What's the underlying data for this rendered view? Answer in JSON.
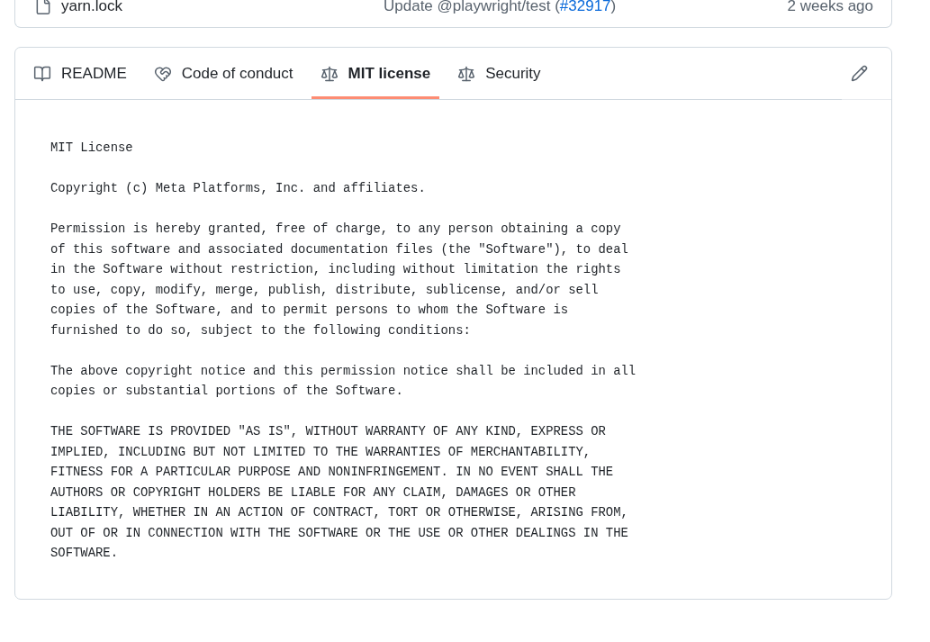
{
  "file_row": {
    "name": "yarn.lock",
    "commit_message": "Update @playwright/test (",
    "commit_link": "#32917",
    "commit_message_end": ")",
    "time": "2 weeks ago"
  },
  "tabs": [
    {
      "kind": "book",
      "label": "README",
      "selected": false
    },
    {
      "kind": "handshake",
      "label": "Code of conduct",
      "selected": false
    },
    {
      "kind": "scale",
      "label": "MIT license",
      "selected": true
    },
    {
      "kind": "scale",
      "label": "Security",
      "selected": false
    }
  ],
  "license": {
    "title": "MIT License",
    "paragraphs": [
      "Copyright (c) Meta Platforms, Inc. and affiliates.",
      "Permission is hereby granted, free of charge, to any person obtaining a copy\nof this software and associated documentation files (the \"Software\"), to deal\nin the Software without restriction, including without limitation the rights\nto use, copy, modify, merge, publish, distribute, sublicense, and/or sell\ncopies of the Software, and to permit persons to whom the Software is\nfurnished to do so, subject to the following conditions:",
      "The above copyright notice and this permission notice shall be included in all\ncopies or substantial portions of the Software.",
      "THE SOFTWARE IS PROVIDED \"AS IS\", WITHOUT WARRANTY OF ANY KIND, EXPRESS OR\nIMPLIED, INCLUDING BUT NOT LIMITED TO THE WARRANTIES OF MERCHANTABILITY,\nFITNESS FOR A PARTICULAR PURPOSE AND NONINFRINGEMENT. IN NO EVENT SHALL THE\nAUTHORS OR COPYRIGHT HOLDERS BE LIABLE FOR ANY CLAIM, DAMAGES OR OTHER\nLIABILITY, WHETHER IN AN ACTION OF CONTRACT, TORT OR OTHERWISE, ARISING FROM,\nOUT OF OR IN CONNECTION WITH THE SOFTWARE OR THE USE OR OTHER DEALINGS IN THE\nSOFTWARE."
    ]
  }
}
